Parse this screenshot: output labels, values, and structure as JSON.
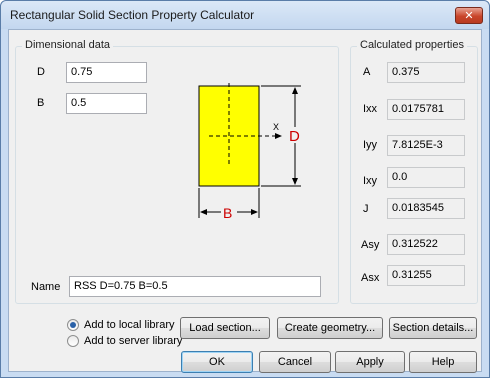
{
  "window": {
    "title": "Rectangular Solid Section Property Calculator",
    "close_glyph": "✕"
  },
  "dimensional": {
    "legend": "Dimensional data",
    "fields": [
      {
        "label": "D",
        "value": "0.75"
      },
      {
        "label": "B",
        "value": "0.5"
      }
    ]
  },
  "diagram": {
    "y_axis": "Y",
    "x_axis": "X",
    "depth_label": "D",
    "width_label": "B",
    "fill_color": "#ffff00",
    "dim_color": "#cc0000"
  },
  "name": {
    "label": "Name",
    "value": "RSS D=0.75 B=0.5"
  },
  "calculated": {
    "legend": "Calculated properties",
    "rows": [
      {
        "label": "A",
        "value": "0.375"
      },
      {
        "label": "Ixx",
        "value": "0.0175781"
      },
      {
        "label": "Iyy",
        "value": "7.8125E-3"
      },
      {
        "label": "Ixy",
        "value": "0.0"
      },
      {
        "label": "J",
        "value": "0.0183545"
      },
      {
        "label": "Asy",
        "value": "0.312522"
      },
      {
        "label": "Asx",
        "value": "0.31255"
      }
    ]
  },
  "library": {
    "local_label": "Add to local library",
    "server_label": "Add to server library",
    "selected": "local"
  },
  "buttons": {
    "load_section": "Load section...",
    "create_geometry": "Create geometry...",
    "section_details": "Section details...",
    "ok": "OK",
    "cancel": "Cancel",
    "apply": "Apply",
    "help": "Help"
  }
}
